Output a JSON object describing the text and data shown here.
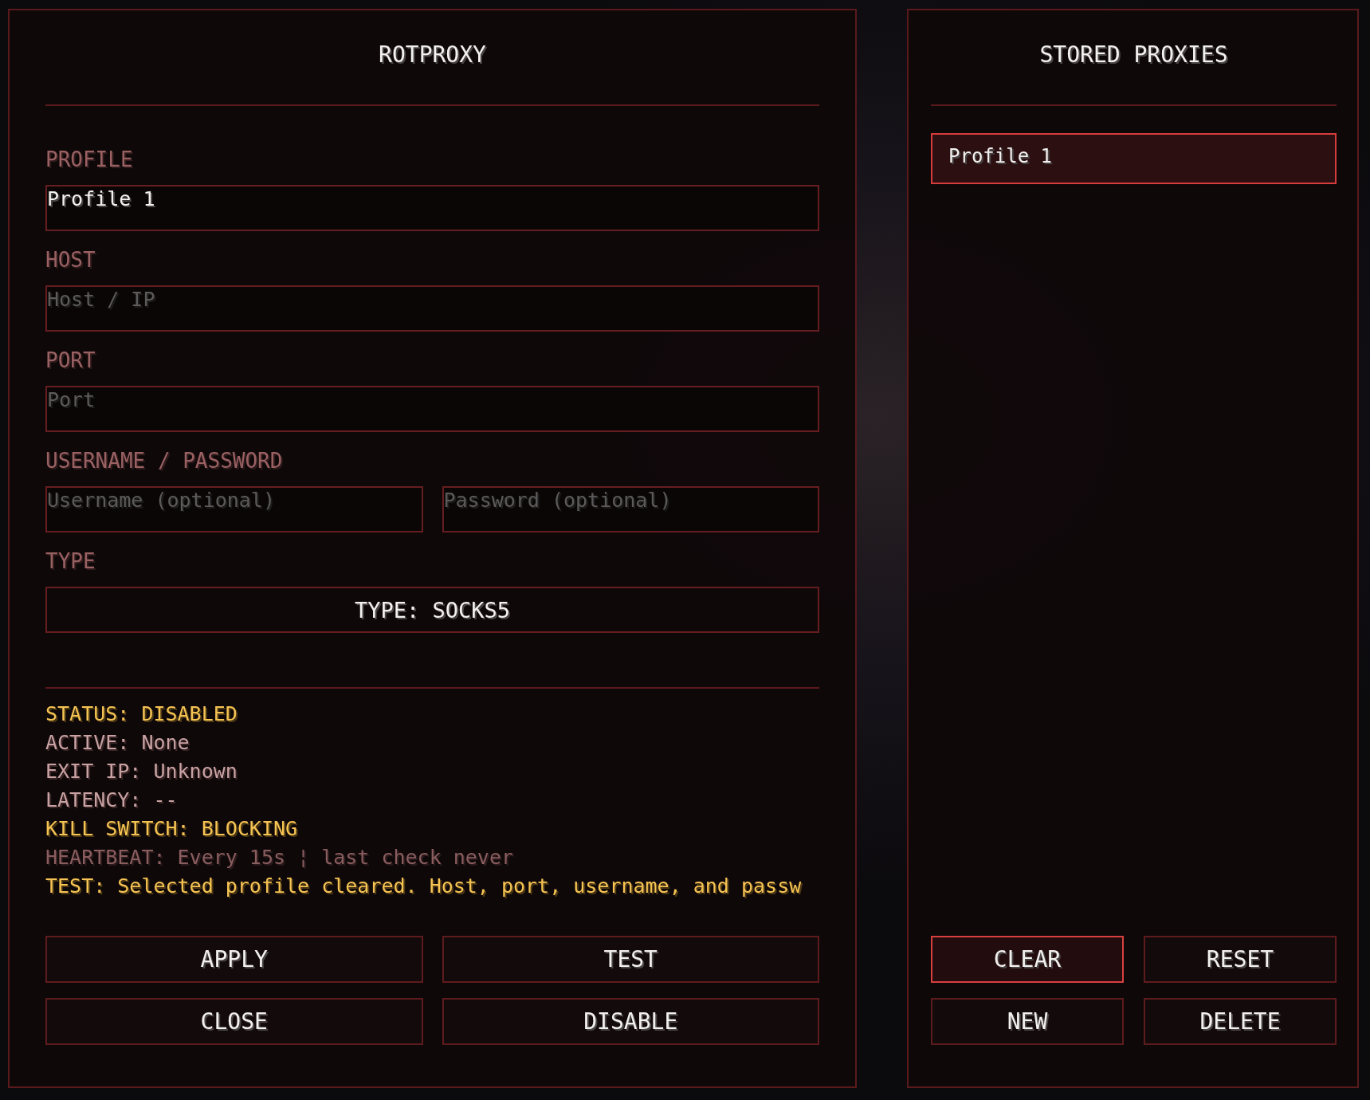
{
  "main_panel": {
    "title": "ROTPROXY",
    "fields": [
      {
        "kind": "text",
        "label": "PROFILE",
        "inputs": [
          {
            "value": "Profile 1"
          }
        ]
      },
      {
        "kind": "text",
        "label": "HOST",
        "inputs": [
          {
            "placeholder": "Host / IP"
          }
        ]
      },
      {
        "kind": "text",
        "label": "PORT",
        "inputs": [
          {
            "placeholder": "Port"
          }
        ]
      },
      {
        "kind": "text",
        "label": "USERNAME / PASSWORD",
        "inputs": [
          {
            "placeholder": "Username (optional)"
          },
          {
            "placeholder": "Password (optional)"
          }
        ]
      },
      {
        "kind": "cycle",
        "label": "TYPE",
        "button": "TYPE: SOCKS5"
      }
    ],
    "status_lines": [
      {
        "kind": "warning",
        "text": "STATUS: DISABLED"
      },
      {
        "kind": "info",
        "text": "ACTIVE: None"
      },
      {
        "kind": "info",
        "text": "EXIT IP: Unknown"
      },
      {
        "kind": "info",
        "text": "LATENCY: --"
      },
      {
        "kind": "warning",
        "text": "KILL SWITCH: BLOCKING"
      },
      {
        "kind": "muted",
        "text": "HEARTBEAT: Every 15s ¦ last check never"
      },
      {
        "kind": "warning",
        "text": "TEST: Selected profile cleared. Host, port, username, and passw"
      }
    ],
    "buttons": [
      {
        "label": "APPLY",
        "focused": false
      },
      {
        "label": "TEST",
        "focused": false
      },
      {
        "label": "CLOSE",
        "focused": false
      },
      {
        "label": "DISABLE",
        "focused": false
      }
    ]
  },
  "stored_proxies": {
    "title": "STORED PROXIES",
    "items": [
      {
        "label": "Profile 1",
        "selected": true
      }
    ],
    "buttons": [
      {
        "label": "CLEAR",
        "focused": true
      },
      {
        "label": "RESET",
        "focused": false
      },
      {
        "label": "NEW",
        "focused": false
      },
      {
        "label": "DELETE",
        "focused": false
      }
    ]
  }
}
